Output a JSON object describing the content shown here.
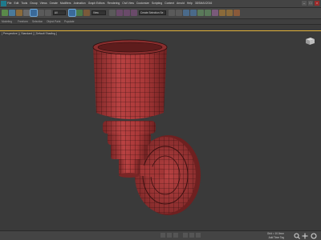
{
  "menubar": {
    "items": [
      "File",
      "Edit",
      "Tools",
      "Group",
      "Views",
      "Create",
      "Modifiers",
      "Animation",
      "Graph Editors",
      "Rendering",
      "Civil View",
      "Customize",
      "Scripting",
      "Content",
      "Arnold",
      "Help",
      "3DSMAX2016"
    ]
  },
  "toolbar": {
    "filter_dropdown": "All",
    "view_dropdown": "View",
    "selection_set": "Create Selection Se"
  },
  "ribbon": {
    "tabs": [
      "Modeling",
      "Freeform",
      "Selection",
      "Object Paint",
      "Populate"
    ]
  },
  "viewport": {
    "label": "[ Perspective ] [ Standard ] [ Default Shading ]",
    "model_color": "#b03a3a",
    "wire_color": "#2a0c0c",
    "background": "#3a3a3a"
  },
  "statusbar": {
    "grid_text": "Grid = 10.0mm",
    "add_time_tag": "Add Time Tag"
  },
  "colors": {
    "accent_blue": "#6fa8d8",
    "viewport_border": "#e2b23a"
  }
}
